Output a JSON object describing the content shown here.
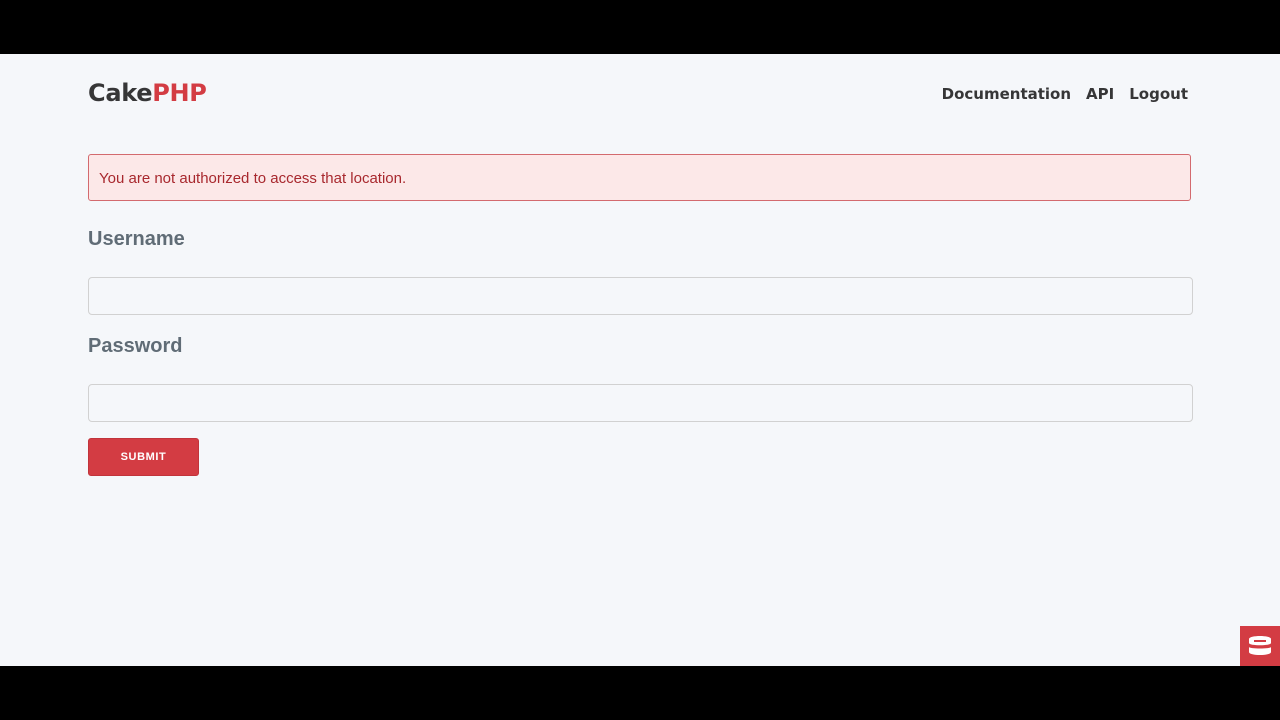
{
  "header": {
    "brand_part1": "Cake",
    "brand_part2": "PHP",
    "nav": [
      "Documentation",
      "API",
      "Logout"
    ]
  },
  "flash": {
    "message": "You are not authorized to access that location."
  },
  "form": {
    "username_label": "Username",
    "username_value": "",
    "password_label": "Password",
    "password_value": "",
    "submit_label": "SUBMIT"
  },
  "colors": {
    "brand_red": "#d33c43",
    "page_bg": "#f5f7fa",
    "text_dark": "#363637",
    "label_gray": "#606c76",
    "flash_bg": "#fce8e8",
    "flash_text": "#a8282e"
  },
  "icons": {
    "debug_badge": "cakephp-debug-kit-icon"
  }
}
